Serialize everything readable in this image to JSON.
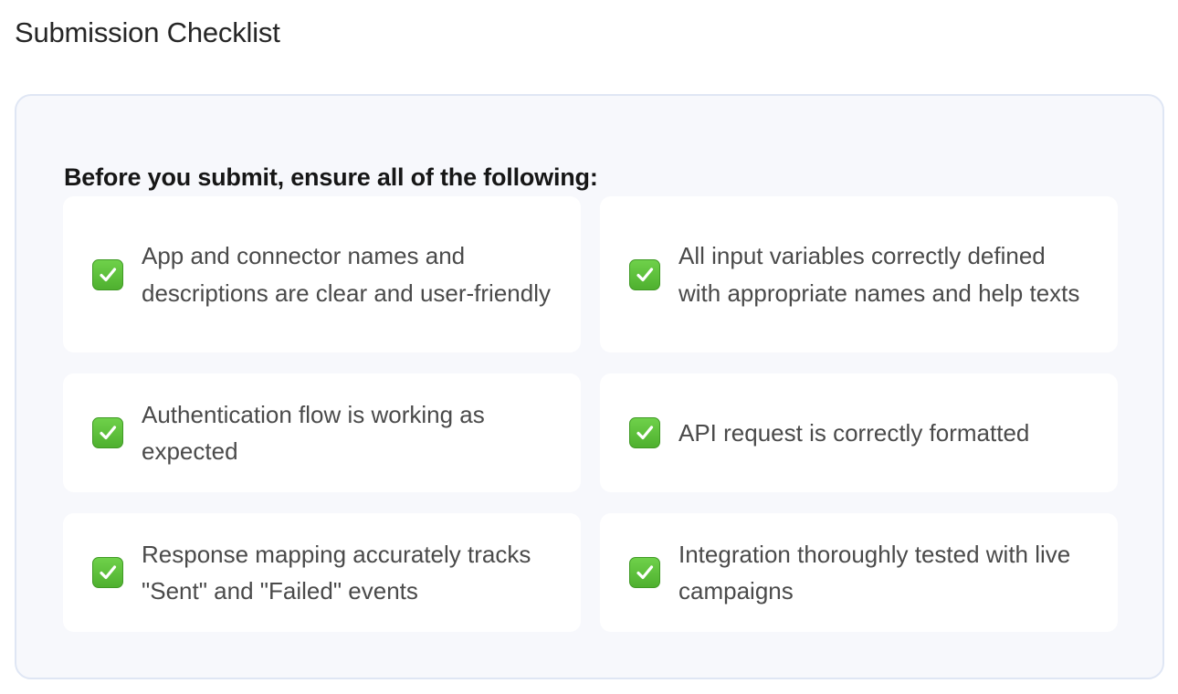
{
  "page": {
    "title": "Submission Checklist"
  },
  "checklist": {
    "heading": "Before you submit, ensure all of the following:",
    "items": [
      {
        "icon": "check-mark-icon",
        "text": "App and connector names and descriptions are clear and user-friendly"
      },
      {
        "icon": "check-mark-icon",
        "text": "All input variables correctly defined with appropriate names and help texts"
      },
      {
        "icon": "check-mark-icon",
        "text": "Authentication flow is working as expected"
      },
      {
        "icon": "check-mark-icon",
        "text": "API request is correctly formatted"
      },
      {
        "icon": "check-mark-icon",
        "text": "Response mapping accurately tracks \"Sent\" and \"Failed\" events"
      },
      {
        "icon": "check-mark-icon",
        "text": "Integration thoroughly tested with live campaigns"
      }
    ]
  },
  "colors": {
    "check_green": "#5cbf3a",
    "panel_background": "#f7f8fc",
    "panel_border": "#dfe6f4"
  }
}
